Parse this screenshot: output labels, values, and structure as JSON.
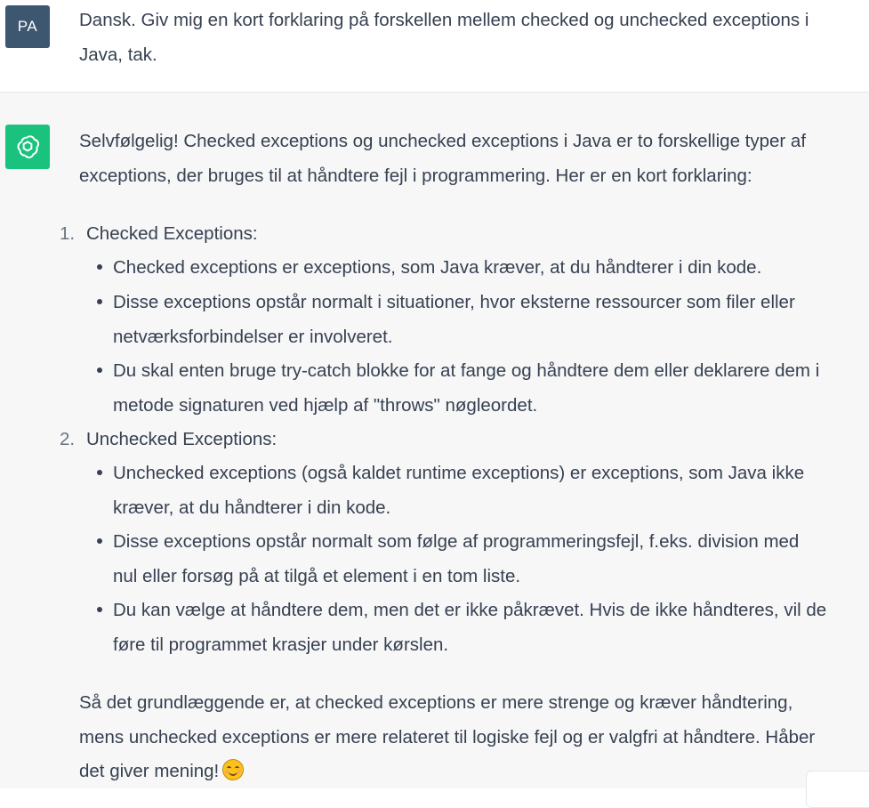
{
  "user": {
    "avatar_initials": "PA",
    "message_lines": [
      "Dansk. Giv mig en kort forklaring på forskellen mellem checked og unchecked exceptions i",
      "Java, tak."
    ]
  },
  "assistant": {
    "avatar_icon": "openai-logo-icon",
    "intro_lines": [
      "Selvfølgelig! Checked exceptions og unchecked exceptions i Java er to forskellige typer af",
      "exceptions, der bruges til at håndtere fejl i programmering. Her er en kort forklaring:"
    ],
    "sections": [
      {
        "number": "1.",
        "title": "Checked Exceptions:",
        "bullets": [
          [
            "Checked exceptions er exceptions, som Java kræver, at du håndterer i din kode."
          ],
          [
            "Disse exceptions opstår normalt i situationer, hvor eksterne ressourcer som filer eller",
            "netværksforbindelser er involveret."
          ],
          [
            "Du skal enten bruge try-catch blokke for at fange og håndtere dem eller deklarere dem i",
            "metode signaturen ved hjælp af \"throws\" nøgleordet."
          ]
        ]
      },
      {
        "number": "2.",
        "title": "Unchecked Exceptions:",
        "bullets": [
          [
            "Unchecked exceptions (også kaldet runtime exceptions) er exceptions, som Java ikke",
            "kræver, at du håndterer i din kode."
          ],
          [
            "Disse exceptions opstår normalt som følge af programmeringsfejl, f.eks. division med",
            "nul eller forsøg på at tilgå et element i en tom liste."
          ],
          [
            "Du kan vælge at håndtere dem, men det er ikke påkrævet. Hvis de ikke håndteres, vil de",
            "føre til programmet krasjer under kørslen."
          ]
        ]
      }
    ],
    "outro_lines": [
      "Så det grundlæggende er, at checked exceptions er mere strenge og kræver håndtering,",
      "mens unchecked exceptions er mere relateret til logiske fejl og er valgfri at håndtere. Håber",
      "det giver mening!"
    ],
    "outro_emoji": "smiling-face-emoji"
  },
  "colors": {
    "user_avatar_bg": "#3d5770",
    "bot_avatar_bg": "#19c37d",
    "assistant_row_bg": "#f7f7f8",
    "text": "#374151"
  }
}
